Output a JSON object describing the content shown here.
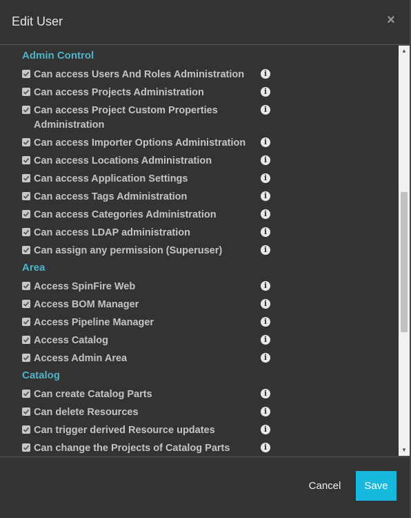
{
  "dialog": {
    "title": "Edit User",
    "close_symbol": "×"
  },
  "sections": [
    {
      "title": "Admin Control",
      "items": [
        {
          "label": "Can access Users And Roles Administration",
          "checked": true
        },
        {
          "label": "Can access Projects Administration",
          "checked": true
        },
        {
          "label": "Can access Project Custom Properties Administration",
          "checked": true
        },
        {
          "label": "Can access Importer Options Administration",
          "checked": true
        },
        {
          "label": "Can access Locations Administration",
          "checked": true
        },
        {
          "label": "Can access Application Settings",
          "checked": true
        },
        {
          "label": "Can access Tags Administration",
          "checked": true
        },
        {
          "label": "Can access Categories Administration",
          "checked": true
        },
        {
          "label": "Can access LDAP administration",
          "checked": true
        },
        {
          "label": "Can assign any permission (Superuser)",
          "checked": true
        }
      ]
    },
    {
      "title": "Area",
      "items": [
        {
          "label": "Access SpinFire Web",
          "checked": true
        },
        {
          "label": "Access BOM Manager",
          "checked": true
        },
        {
          "label": "Access Pipeline Manager",
          "checked": true
        },
        {
          "label": "Access Catalog",
          "checked": true
        },
        {
          "label": "Access Admin Area",
          "checked": true
        }
      ]
    },
    {
      "title": "Catalog",
      "items": [
        {
          "label": "Can create Catalog Parts",
          "checked": true
        },
        {
          "label": "Can delete Resources",
          "checked": true
        },
        {
          "label": "Can trigger derived Resource updates",
          "checked": true
        },
        {
          "label": "Can change the Projects of Catalog Parts",
          "checked": true
        }
      ]
    }
  ],
  "icons": {
    "info": "i"
  },
  "footer": {
    "cancel_label": "Cancel",
    "save_label": "Save"
  },
  "colors": {
    "section_title": "#4fb3c8",
    "save_button": "#17b8dd",
    "background": "#333333"
  }
}
